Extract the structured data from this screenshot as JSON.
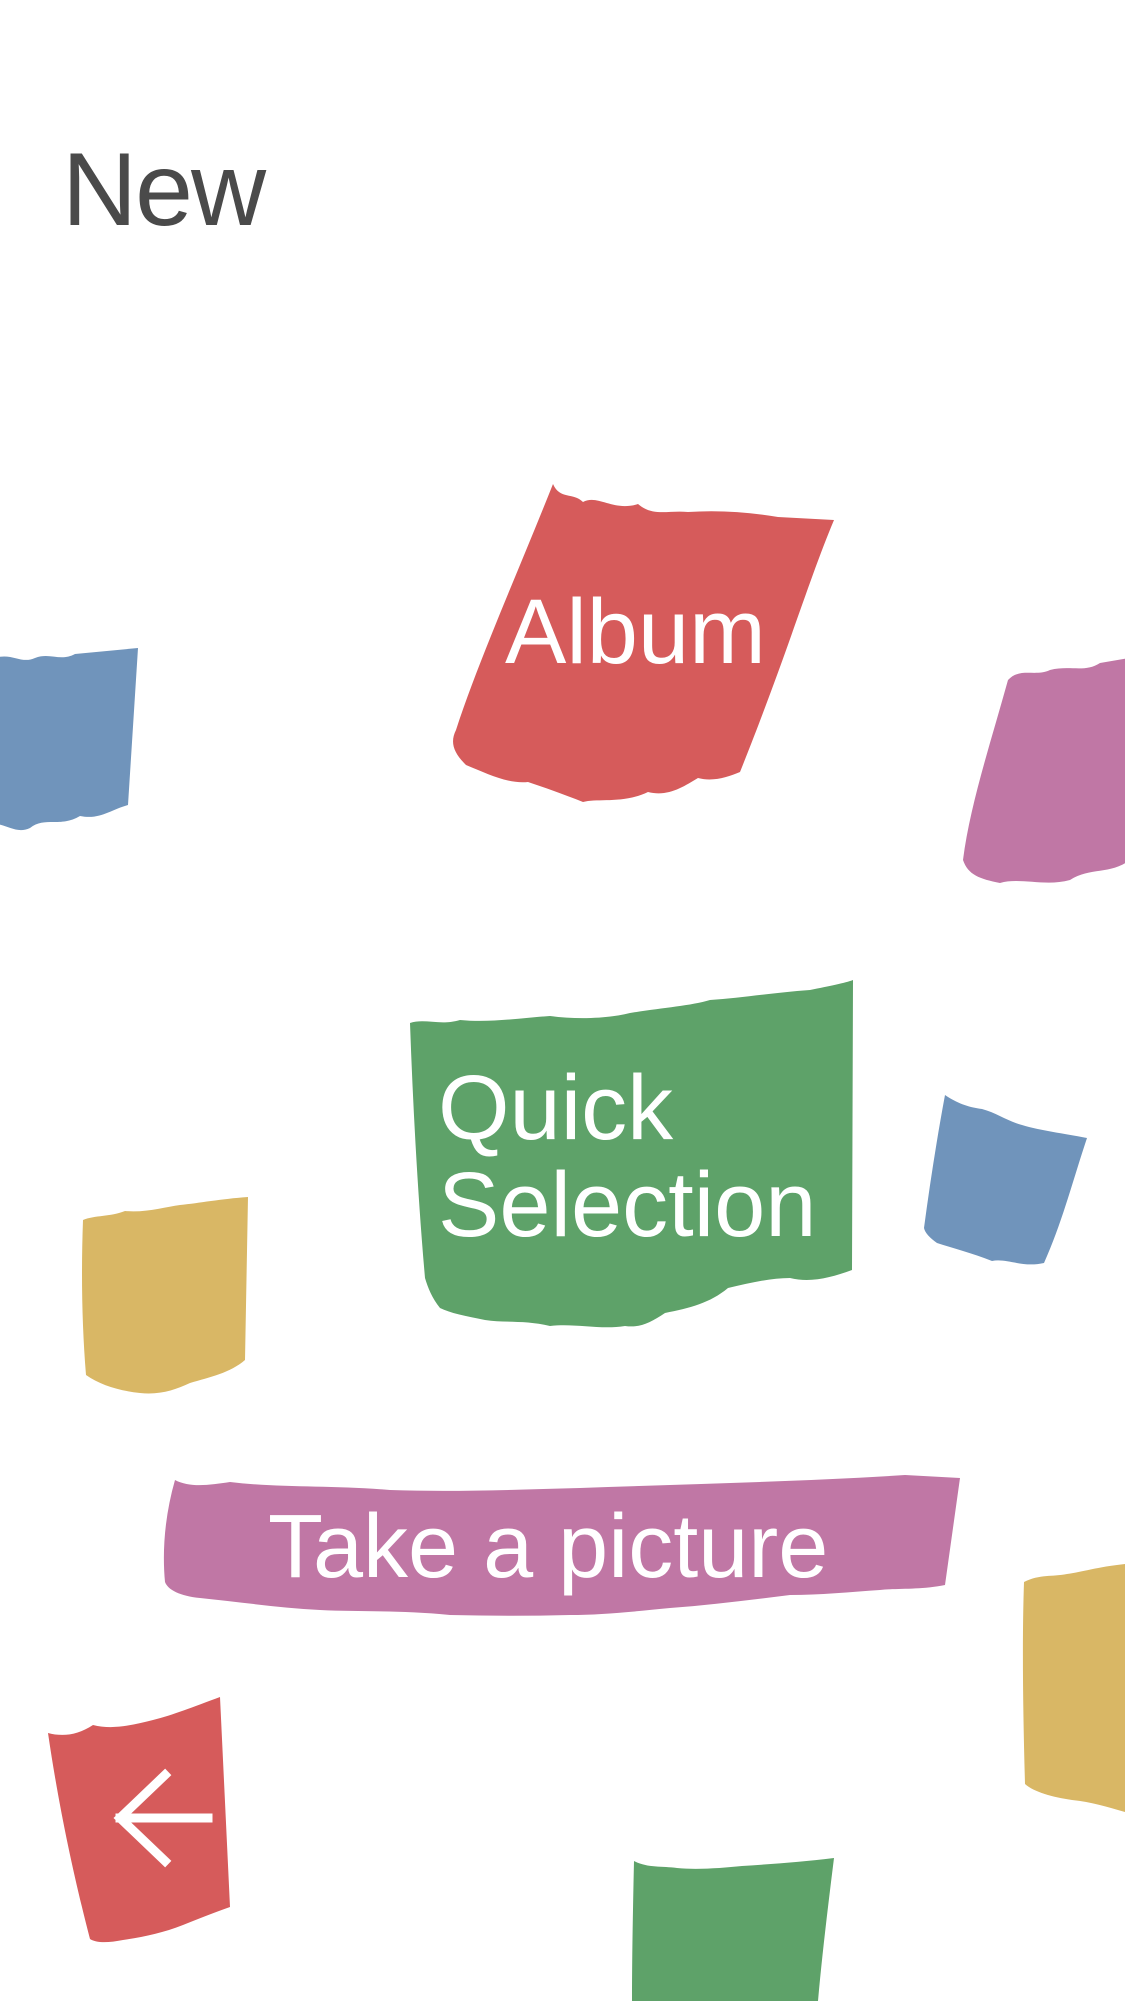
{
  "header": {
    "title": "New"
  },
  "buttons": {
    "album": "Album",
    "quick_selection_line1": "Quick",
    "quick_selection_line2": "Selection",
    "take_picture": "Take a picture",
    "back_icon": "back-arrow-icon"
  },
  "colors": {
    "red": "#d65b5b",
    "green": "#5ea269",
    "pink": "#c077a5",
    "blue": "#7094bb",
    "yellow": "#d9b765",
    "title": "#4a4a4a",
    "background": "#ffffff"
  }
}
